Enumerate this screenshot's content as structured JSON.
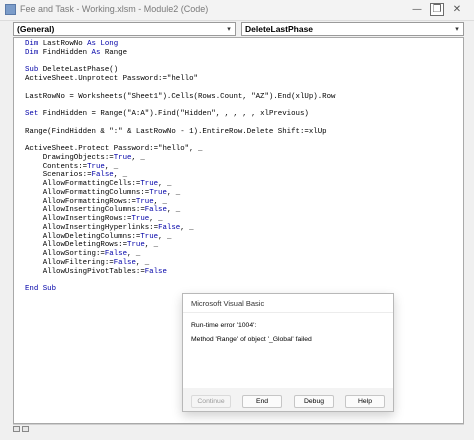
{
  "window": {
    "title": "Fee and Task - Working.xlsm - Module2 (Code)",
    "controls": {
      "minimize": "—",
      "restore": "❐",
      "close": "✕"
    }
  },
  "toolbar": {
    "object_combo": "(General)",
    "procedure_combo": "DeleteLastPhase",
    "dropdown_arrow": "▾"
  },
  "code_lines": [
    [
      [
        "kw",
        "Dim"
      ],
      [
        "t",
        " LastRowNo "
      ],
      [
        "kw",
        "As Long"
      ]
    ],
    [
      [
        "kw",
        "Dim"
      ],
      [
        "t",
        " FindHidden "
      ],
      [
        "kw",
        "As"
      ],
      [
        "t",
        " Range"
      ]
    ],
    [
      [
        "t",
        ""
      ]
    ],
    [
      [
        "kw",
        "Sub"
      ],
      [
        "t",
        " DeleteLastPhase()"
      ]
    ],
    [
      [
        "t",
        "ActiveSheet.Unprotect Password:=\"hello\""
      ]
    ],
    [
      [
        "t",
        ""
      ]
    ],
    [
      [
        "t",
        "LastRowNo = Worksheets(\"Sheet1\").Cells(Rows.Count, \"AZ\").End(xlUp).Row"
      ]
    ],
    [
      [
        "t",
        ""
      ]
    ],
    [
      [
        "kw",
        "Set"
      ],
      [
        "t",
        " FindHidden = Range(\"A:A\").Find(\"Hidden\", , , , , xlPrevious)"
      ]
    ],
    [
      [
        "t",
        ""
      ]
    ],
    [
      [
        "t",
        "Range(FindHidden & \":\" & LastRowNo - 1).EntireRow.Delete Shift:=xlUp"
      ]
    ],
    [
      [
        "t",
        ""
      ]
    ],
    [
      [
        "t",
        "ActiveSheet.Protect Password:=\"hello\", _"
      ]
    ],
    [
      [
        "t",
        "    DrawingObjects:="
      ],
      [
        "kw",
        "True"
      ],
      [
        "t",
        ", _"
      ]
    ],
    [
      [
        "t",
        "    Contents:="
      ],
      [
        "kw",
        "True"
      ],
      [
        "t",
        ", _"
      ]
    ],
    [
      [
        "t",
        "    Scenarios:="
      ],
      [
        "kw",
        "False"
      ],
      [
        "t",
        ", _"
      ]
    ],
    [
      [
        "t",
        "    AllowFormattingCells:="
      ],
      [
        "kw",
        "True"
      ],
      [
        "t",
        ", _"
      ]
    ],
    [
      [
        "t",
        "    AllowFormattingColumns:="
      ],
      [
        "kw",
        "True"
      ],
      [
        "t",
        ", _"
      ]
    ],
    [
      [
        "t",
        "    AllowFormattingRows:="
      ],
      [
        "kw",
        "True"
      ],
      [
        "t",
        ", _"
      ]
    ],
    [
      [
        "t",
        "    AllowInsertingColumns:="
      ],
      [
        "kw",
        "False"
      ],
      [
        "t",
        ", _"
      ]
    ],
    [
      [
        "t",
        "    AllowInsertingRows:="
      ],
      [
        "kw",
        "True"
      ],
      [
        "t",
        ", _"
      ]
    ],
    [
      [
        "t",
        "    AllowInsertingHyperlinks:="
      ],
      [
        "kw",
        "False"
      ],
      [
        "t",
        ", _"
      ]
    ],
    [
      [
        "t",
        "    AllowDeletingColumns:="
      ],
      [
        "kw",
        "True"
      ],
      [
        "t",
        ", _"
      ]
    ],
    [
      [
        "t",
        "    AllowDeletingRows:="
      ],
      [
        "kw",
        "True"
      ],
      [
        "t",
        ", _"
      ]
    ],
    [
      [
        "t",
        "    AllowSorting:="
      ],
      [
        "kw",
        "False"
      ],
      [
        "t",
        ", _"
      ]
    ],
    [
      [
        "t",
        "    AllowFiltering:="
      ],
      [
        "kw",
        "False"
      ],
      [
        "t",
        ", _"
      ]
    ],
    [
      [
        "t",
        "    AllowUsingPivotTables:="
      ],
      [
        "kw",
        "False"
      ]
    ],
    [
      [
        "t",
        ""
      ]
    ],
    [
      [
        "kw",
        "End Sub"
      ]
    ]
  ],
  "colors": {
    "keyword": "#0000a8",
    "text": "#000000"
  },
  "dialog": {
    "title": "Microsoft Visual Basic",
    "message_line1": "Run-time error '1004':",
    "message_line2": "Method 'Range' of object '_Global' failed",
    "buttons": {
      "continue": "Continue",
      "end": "End",
      "debug": "Debug",
      "help": "Help"
    }
  }
}
